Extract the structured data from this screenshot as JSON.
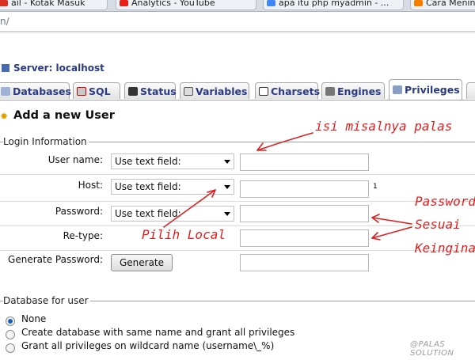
{
  "browser": {
    "tabs": [
      {
        "label": "ail - Kotak Masuk",
        "icon": "gmail-icon",
        "color": "#d93025"
      },
      {
        "label": "Analytics - YouTube",
        "icon": "youtube-icon",
        "color": "#e62117"
      },
      {
        "label": "apa itu php myadmin - ...",
        "icon": "google-icon",
        "color": "#4285f4"
      },
      {
        "label": "Cara Mening",
        "icon": "blogger-icon",
        "color": "#f57d00"
      }
    ],
    "address": "n/"
  },
  "server": {
    "label": "Server: localhost",
    "icon": "server-icon"
  },
  "pma_tabs": [
    {
      "label": "Databases",
      "icon": "databases-icon"
    },
    {
      "label": "SQL",
      "icon": "sql-icon"
    },
    {
      "label": "Status",
      "icon": "status-icon"
    },
    {
      "label": "Variables",
      "icon": "variables-icon"
    },
    {
      "label": "Charsets",
      "icon": "charsets-icon"
    },
    {
      "label": "Engines",
      "icon": "engines-icon"
    },
    {
      "label": "Privileges",
      "icon": "privileges-icon",
      "active": true
    }
  ],
  "heading": "Add a new User",
  "login": {
    "legend": "Login Information",
    "username_label": "User name:",
    "username_select": "Use text field:",
    "host_label": "Host:",
    "host_select": "Use text field:",
    "host_note": "1",
    "password_label": "Password:",
    "password_select": "Use text field:",
    "retype_label": "Re-type:",
    "genpass_label": "Generate Password:",
    "generate_button": "Generate"
  },
  "database": {
    "legend": "Database for user",
    "options": [
      {
        "label": "None",
        "checked": true
      },
      {
        "label": "Create database with same name and grant all privileges",
        "checked": false
      },
      {
        "label": "Grant all privileges on wildcard name (username\\_%)",
        "checked": false
      }
    ]
  },
  "annotations": {
    "palas": "isi misalnya palas",
    "local": "Pilih Local",
    "pw1": "Password",
    "pw2": "Sesuai",
    "pw3": "Keinginan"
  },
  "watermark": "@PALAS SOLUTION",
  "colors": {
    "annotation": "#e02020",
    "link": "#2a3b86"
  }
}
